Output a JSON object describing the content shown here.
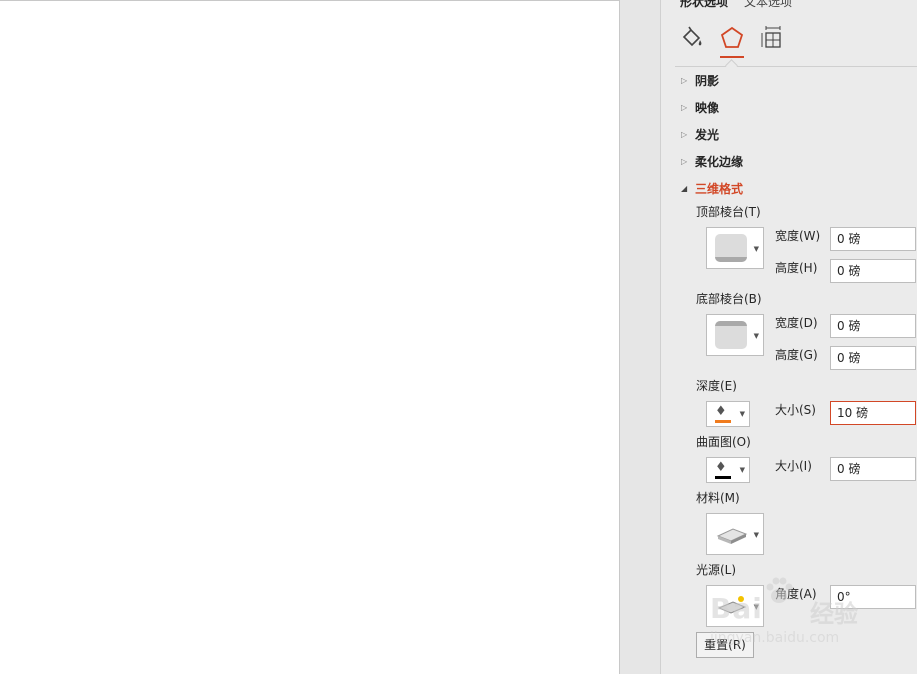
{
  "pane": {
    "tabs": {
      "shape_options": "形状选项",
      "text_options": "文本选项"
    },
    "categories": [
      {
        "icon": "fill-line-icon"
      },
      {
        "icon": "effects-pentagon-icon"
      },
      {
        "icon": "size-properties-icon"
      }
    ],
    "sections": {
      "shadow": "阴影",
      "reflection": "映像",
      "glow": "发光",
      "soft_edges": "柔化边缘",
      "format_3d": "三维格式"
    },
    "format3d": {
      "top_bevel": {
        "label": "顶部棱台(T)",
        "width_label": "宽度(W)",
        "width_value": "0 磅",
        "height_label": "高度(H)",
        "height_value": "0 磅"
      },
      "bottom_bevel": {
        "label": "底部棱台(B)",
        "width_label": "宽度(D)",
        "width_value": "0 磅",
        "height_label": "高度(G)",
        "height_value": "0 磅"
      },
      "depth": {
        "label": "深度(E)",
        "size_label": "大小(S)",
        "size_value": "10 磅",
        "color": "#f07b1d"
      },
      "contour": {
        "label": "曲面图(O)",
        "size_label": "大小(I)",
        "size_value": "0 磅",
        "color": "#000000"
      },
      "material": {
        "label": "材料(M)"
      },
      "lighting": {
        "label": "光源(L)",
        "angle_label": "角度(A)",
        "angle_value": "0°"
      },
      "reset_label": "重置(R)"
    },
    "accent_color": "#d24726"
  },
  "watermark": {
    "brand": "Bai",
    "brand_cn": "经验",
    "url": "jingyan.baidu.com"
  }
}
